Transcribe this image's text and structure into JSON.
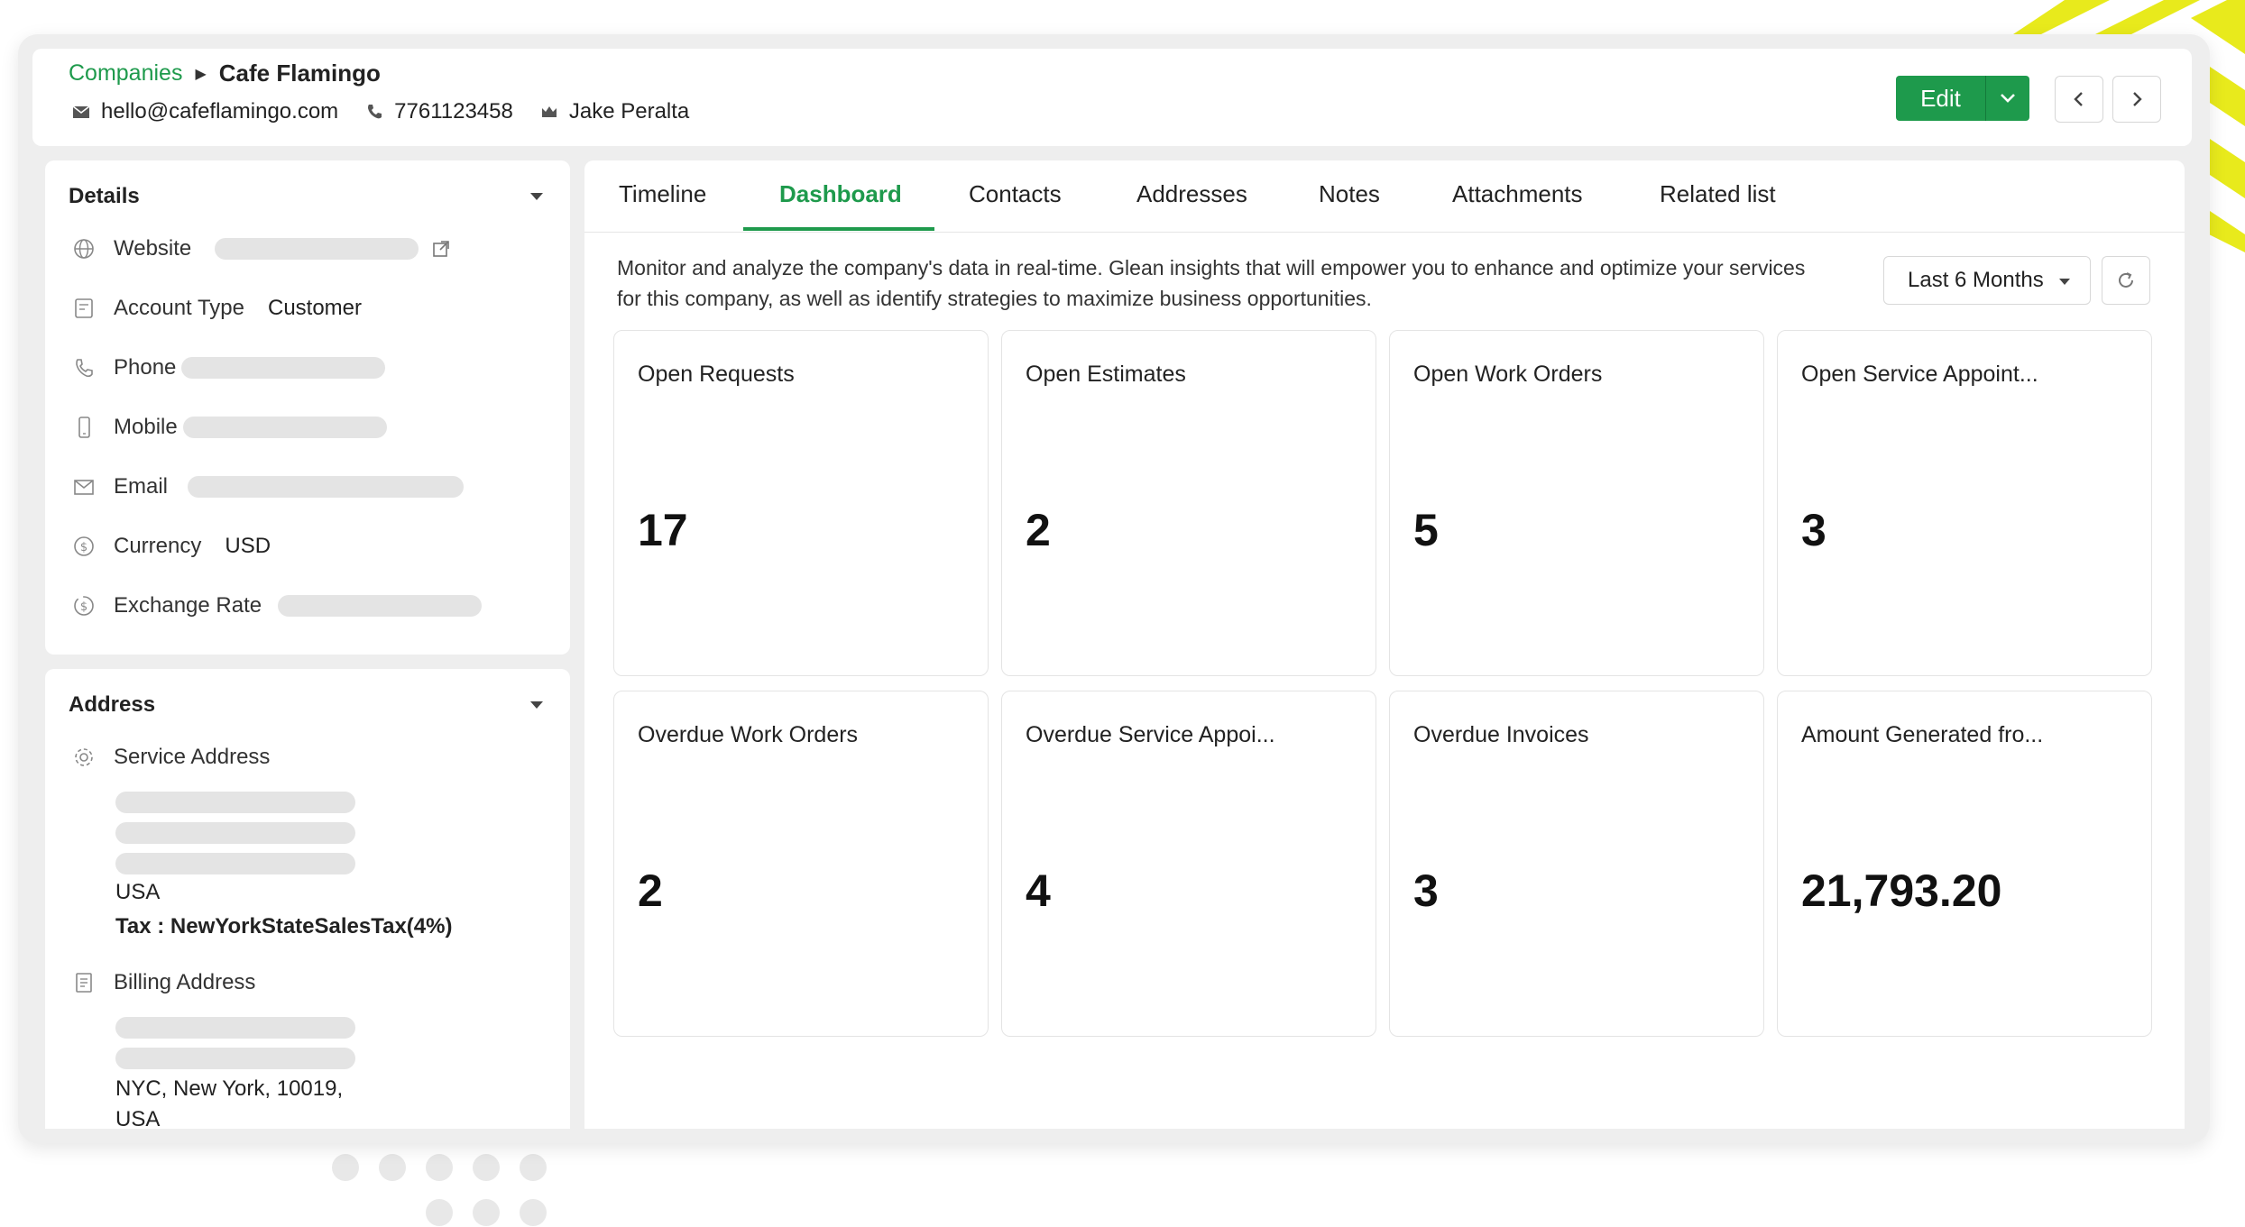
{
  "header": {
    "breadcrumb_parent": "Companies",
    "company_name": "Cafe Flamingo",
    "email": "hello@cafeflamingo.com",
    "phone": "7761123458",
    "owner": "Jake Peralta",
    "edit_label": "Edit"
  },
  "details": {
    "title": "Details",
    "fields": [
      {
        "label": "Website",
        "value": ""
      },
      {
        "label": "Account Type",
        "value": "Customer"
      },
      {
        "label": "Phone",
        "value": ""
      },
      {
        "label": "Mobile",
        "value": ""
      },
      {
        "label": "Email",
        "value": ""
      },
      {
        "label": "Currency",
        "value": "USD"
      },
      {
        "label": "Exchange Rate",
        "value": ""
      }
    ]
  },
  "address": {
    "title": "Address",
    "service_label": "Service Address",
    "service_country": "USA",
    "service_tax": "Tax : NewYorkStateSalesTax(4%)",
    "billing_label": "Billing Address",
    "billing_line": "NYC, New York, 10019,",
    "billing_country": "USA"
  },
  "tabs": [
    "Timeline",
    "Dashboard",
    "Contacts",
    "Addresses",
    "Notes",
    "Attachments",
    "Related list"
  ],
  "active_tab": "Dashboard",
  "dashboard": {
    "description": "Monitor and analyze the company's data in real-time. Glean insights that will empower you to enhance and optimize your services for this company, as well as identify strategies to maximize business opportunities.",
    "range": "Last 6 Months",
    "cards": [
      {
        "title": "Open Requests",
        "value": "17"
      },
      {
        "title": "Open Estimates",
        "value": "2"
      },
      {
        "title": "Open Work Orders",
        "value": "5"
      },
      {
        "title": "Open Service Appoint...",
        "value": "3"
      },
      {
        "title": "Overdue Work Orders",
        "value": "2"
      },
      {
        "title": "Overdue Service Appoi...",
        "value": "4"
      },
      {
        "title": "Overdue Invoices",
        "value": "3"
      },
      {
        "title": "Amount Generated fro...",
        "value": "21,793.20"
      }
    ]
  },
  "colors": {
    "accent": "#1e9a4c",
    "decor_stripes": "#e8ea1c"
  }
}
